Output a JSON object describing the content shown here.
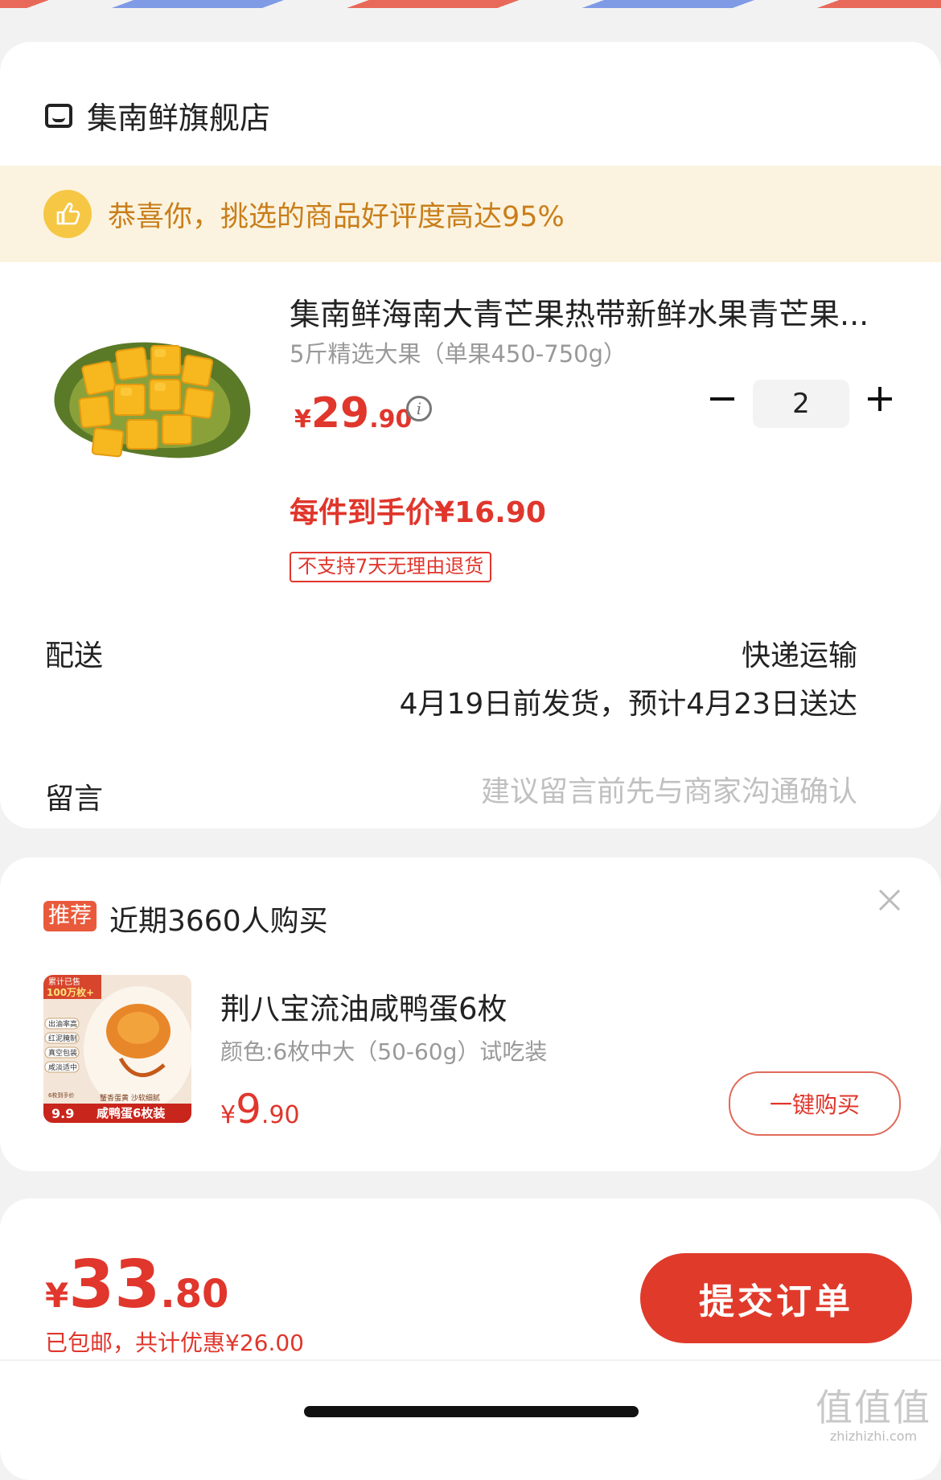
{
  "store": {
    "name": "集南鲜旗舰店",
    "praise": "恭喜你，挑选的商品好评度高达95%"
  },
  "product": {
    "title": "集南鲜海南大青芒果热带新鲜水果青芒果...",
    "spec": "5斤精选大果（单果450-750g）",
    "price_symbol": "¥",
    "price_int": "29",
    "price_dec": ".90",
    "quantity": "2",
    "final_price": "每件到手价¥16.90",
    "no_return": "不支持7天无理由退货"
  },
  "delivery": {
    "label": "配送",
    "method": "快递运输",
    "date": "4月19日前发货，预计4月23日送达"
  },
  "message": {
    "label": "留言",
    "placeholder": "建议留言前先与商家沟通确认"
  },
  "recommend": {
    "tag": "推荐",
    "title": "近期3660人购买",
    "name": "荆八宝流油咸鸭蛋6枚",
    "spec": "颜色:6枚中大（50-60g）试吃装",
    "price_symbol": "¥",
    "price_int": "9",
    "price_dec": ".90",
    "buy_label": "一键购买",
    "image_text": {
      "sold": "累计已售",
      "sold_count": "100万枚+",
      "tags": [
        "出油率高",
        "红泥腌制",
        "真空包装",
        "咸淡适中"
      ],
      "slogan": "蟹香蛋黄 沙软细腻",
      "price_note": "6枚到手价",
      "price": "9.9",
      "package": "咸鸭蛋6枚装"
    }
  },
  "footer": {
    "price_symbol": "¥",
    "price_int": "33",
    "price_dec": ".80",
    "note": "已包邮，共计优惠¥26.00",
    "submit_label": "提交订单"
  },
  "watermark": {
    "big": "值值值",
    "small": "zhizhizhi.com"
  },
  "colors": {
    "accent": "#e0362c",
    "praise_bg": "#fbf3df",
    "praise_text": "#c97e1a"
  }
}
